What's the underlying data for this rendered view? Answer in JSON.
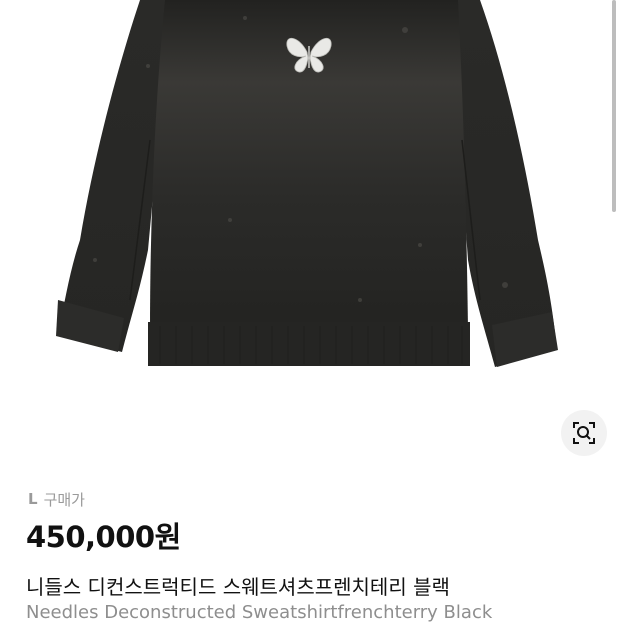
{
  "product": {
    "image_icon": "butterfly-logo-icon",
    "garment_color": "#2e2e2c"
  },
  "lens_button": {
    "icon": "image-search-icon"
  },
  "size": "L",
  "price_label": "구매가",
  "price": "450,000원",
  "name_ko": "니들스 디컨스트럭티드 스웨트셔츠프렌치테리 블랙",
  "name_en": "Needles Deconstructed Sweatshirtfrenchterry Black"
}
